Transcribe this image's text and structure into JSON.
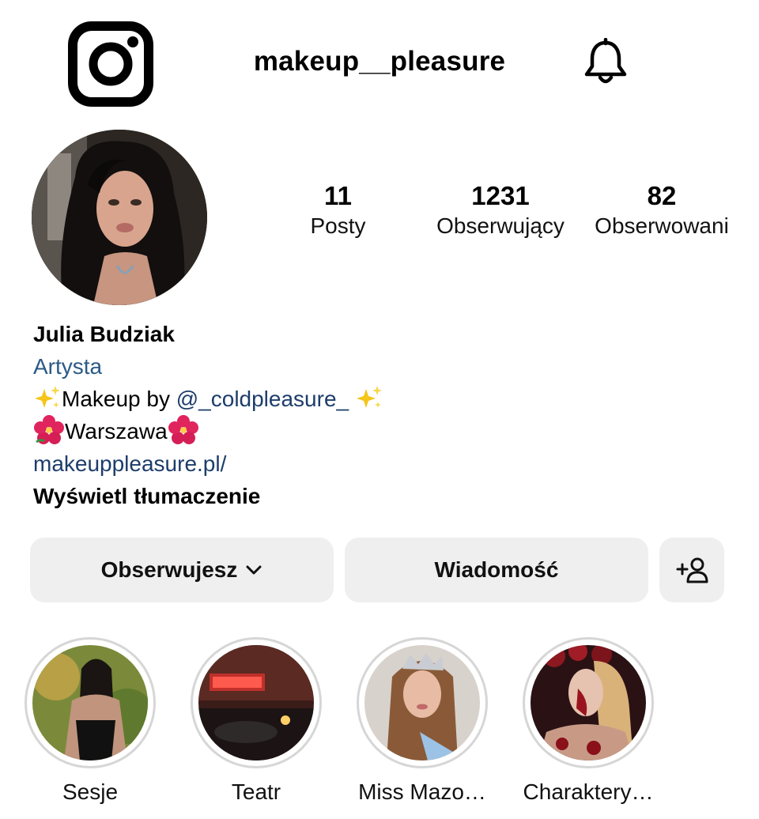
{
  "header": {
    "logo_icon": "instagram-logo-icon",
    "username": "makeup__pleasure",
    "bell_icon": "bell-icon"
  },
  "profile": {
    "avatar_icon": "profile-avatar",
    "stats": [
      {
        "value": "11",
        "label": "Posty"
      },
      {
        "value": "1231",
        "label": "Obserwujący"
      },
      {
        "value": "82",
        "label": "Obserwowani"
      }
    ],
    "name": "Julia Budziak",
    "category": "Artysta",
    "bio_line1_prefix": "Makeup by ",
    "bio_mention": "@_coldpleasure_",
    "bio_line2": "Warszawa",
    "website": "makeuppleasure.pl/",
    "translate_label": "Wyświetl tłumaczenie"
  },
  "actions": {
    "follow_label": "Obserwujesz",
    "message_label": "Wiadomość",
    "add_user_icon": "add-person-icon"
  },
  "highlights": [
    {
      "label": "Sesje"
    },
    {
      "label": "Teatr"
    },
    {
      "label": "Miss Mazo…"
    },
    {
      "label": "Charaktery…"
    }
  ],
  "colors": {
    "link": "#1d3d6b",
    "category": "#2b5a86",
    "button_bg": "#efefef"
  }
}
